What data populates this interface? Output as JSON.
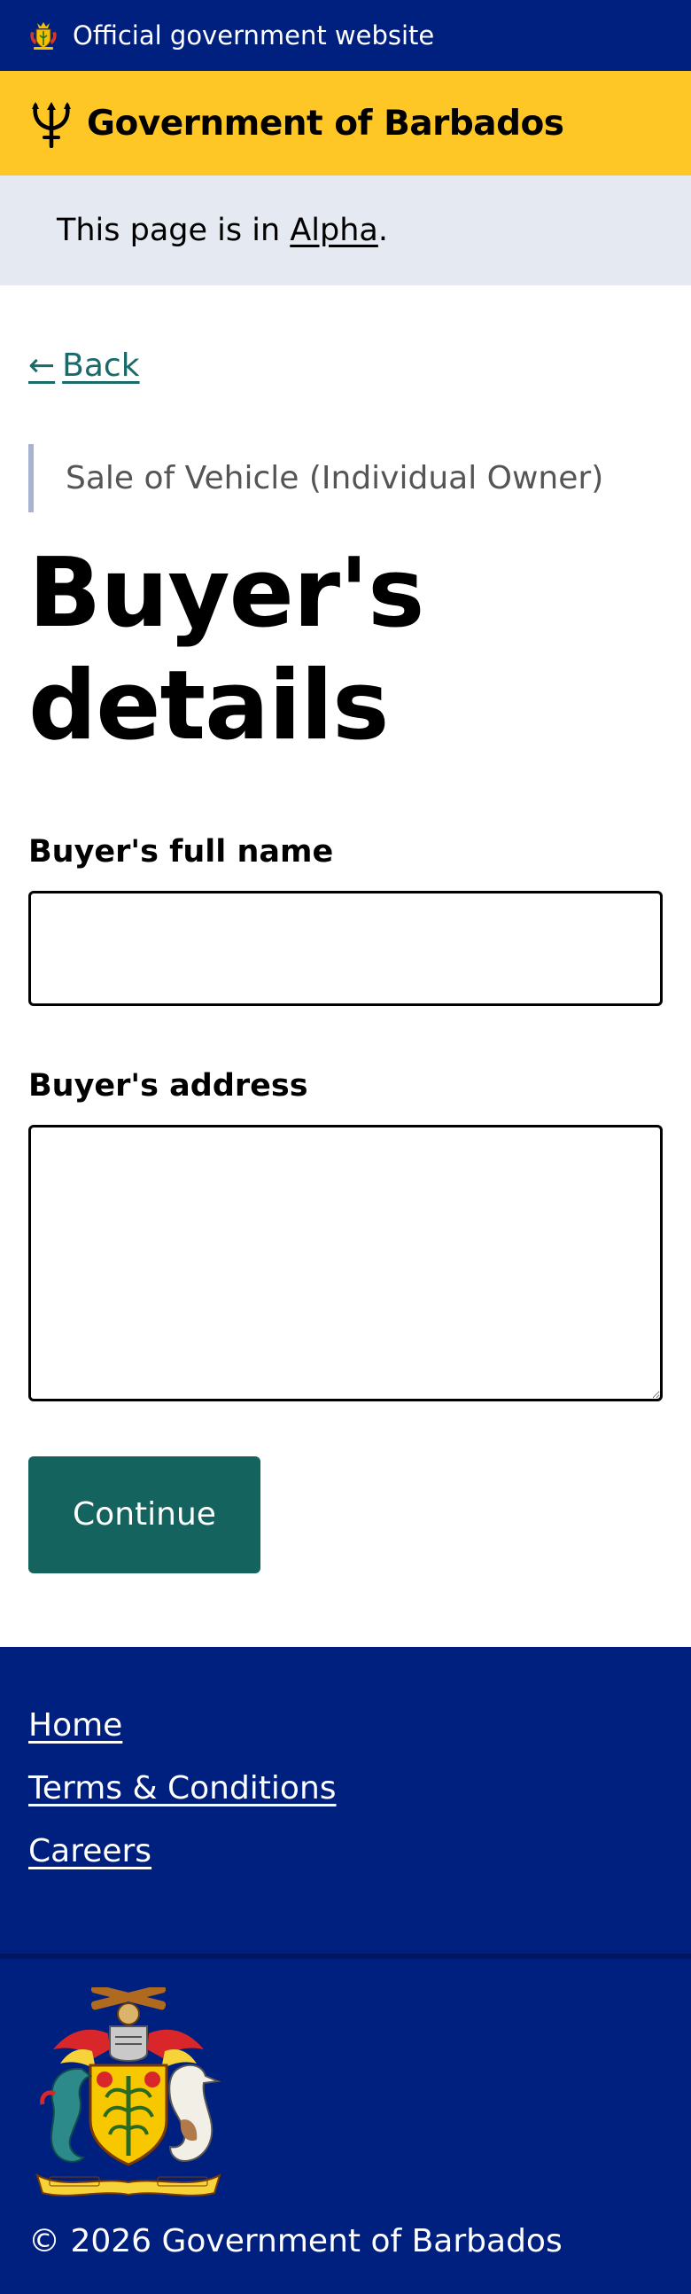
{
  "official_bar": {
    "text": "Official government website",
    "icon": "coat-of-arms-icon"
  },
  "header": {
    "title": "Government of Barbados",
    "icon": "trident-icon",
    "background_color": "#ffc726"
  },
  "phase_banner": {
    "text_before": "This page is in ",
    "link_label": "Alpha",
    "text_after": "."
  },
  "back_link": {
    "arrow": "←",
    "label": "Back"
  },
  "caption": "Sale of Vehicle (Individual Owner)",
  "page_title": "Buyer's details",
  "form": {
    "full_name": {
      "label": "Buyer's full name",
      "value": "",
      "placeholder": ""
    },
    "address": {
      "label": "Buyer's address",
      "value": "",
      "placeholder": ""
    },
    "continue_label": "Continue"
  },
  "footer": {
    "links": [
      "Home",
      "Terms & Conditions",
      "Careers"
    ],
    "copyright": "© 2026 Government of Barbados",
    "background_color": "#00207f"
  },
  "colors": {
    "primary_button": "#15635f",
    "link": "#1a6a6a",
    "official_bar": "#00207f",
    "phase_banner": "#e5e9f1"
  }
}
